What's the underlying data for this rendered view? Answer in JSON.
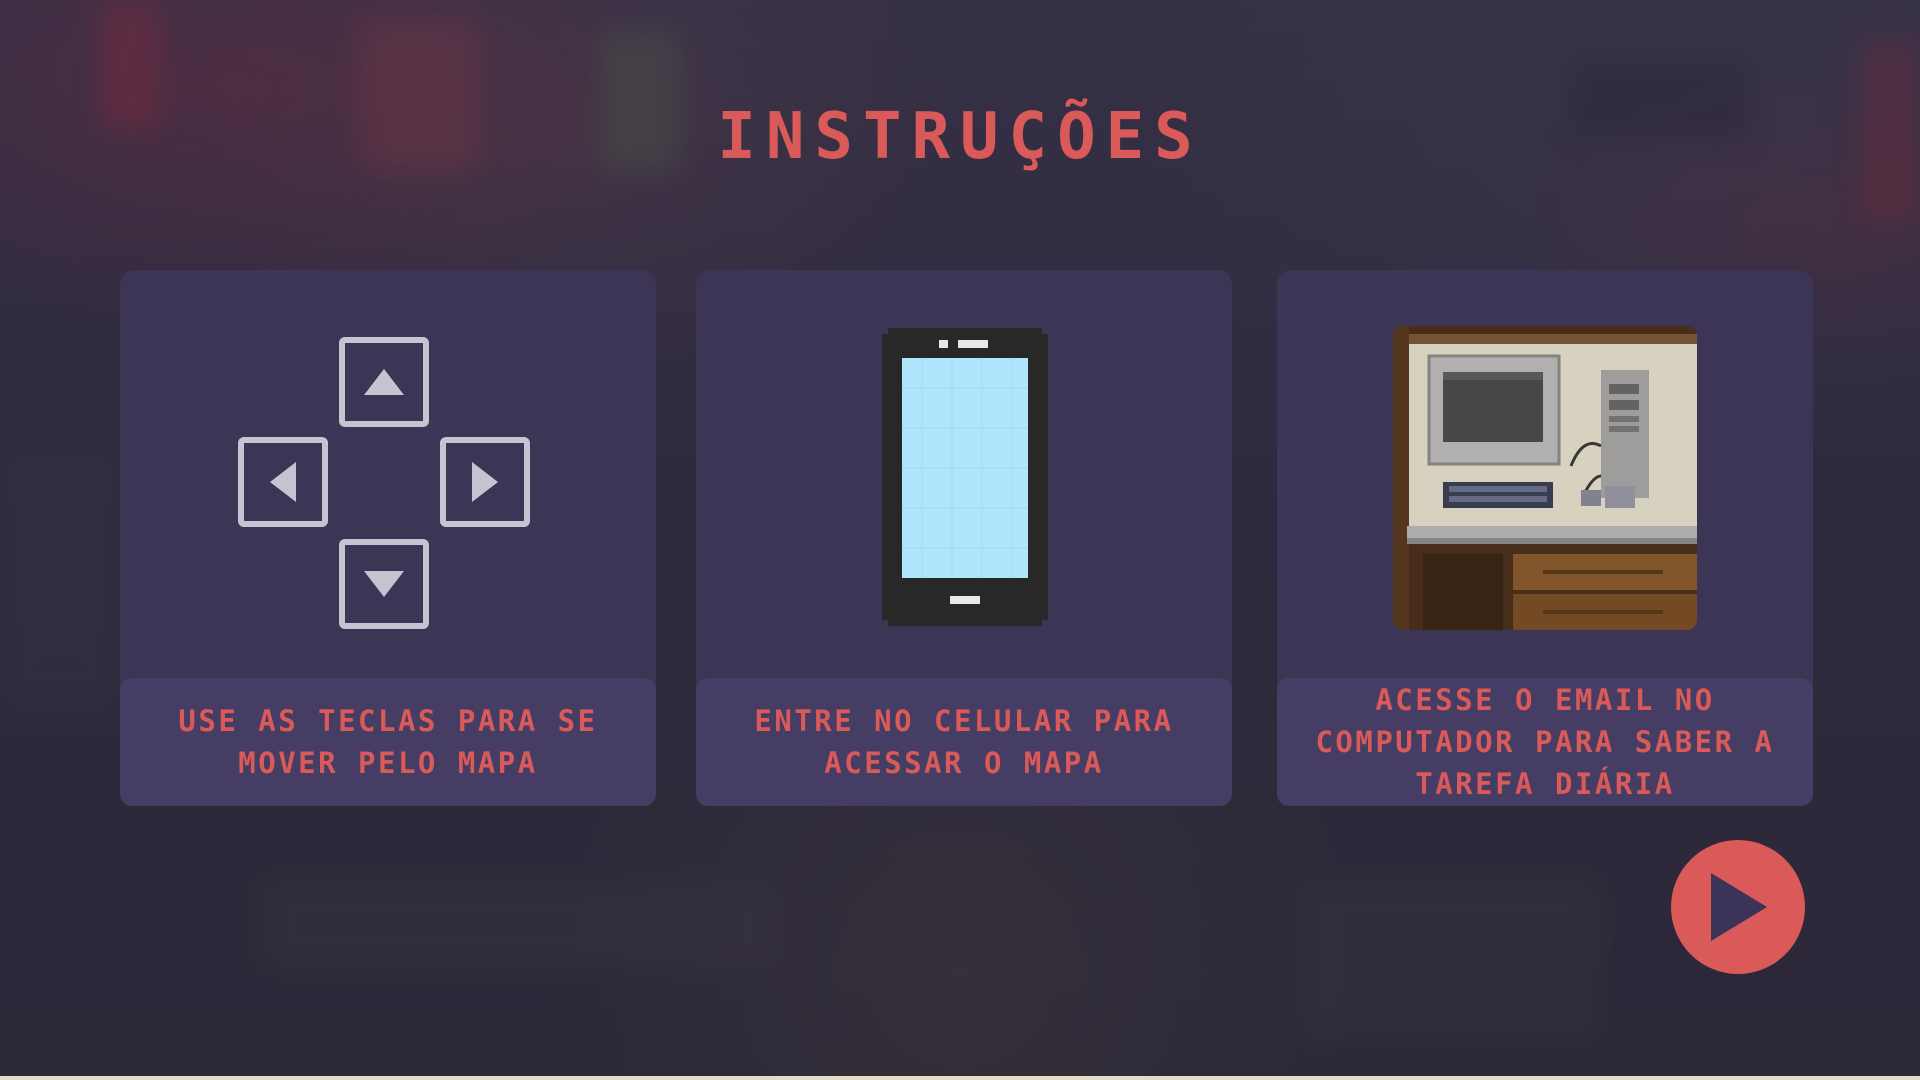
{
  "title": "INSTRUÇÕES",
  "cards": [
    {
      "icon": "arrow-keys-icon",
      "caption": "USE AS TECLAS PARA SE MOVER PELO MAPA"
    },
    {
      "icon": "smartphone-icon",
      "caption": "ENTRE NO CELULAR PARA ACESSAR O MAPA"
    },
    {
      "icon": "computer-desk-image",
      "caption": "ACESSE O EMAIL NO COMPUTADOR PARA SABER A TAREFA DIÁRIA"
    }
  ],
  "play_button": {
    "icon": "play-icon"
  },
  "colors": {
    "accent": "#d95a58",
    "card_bg": "#3c3556",
    "caption_bg": "#453d63",
    "key_border": "#c7c4d2",
    "screen": "#aee7fb"
  }
}
